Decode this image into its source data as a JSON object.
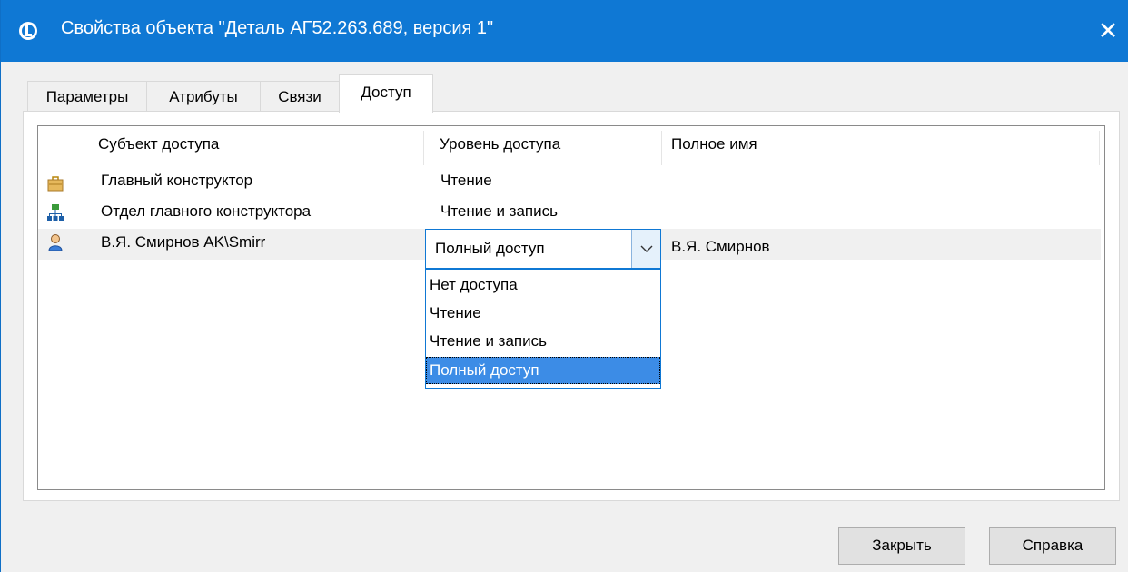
{
  "window": {
    "title": "Свойства объекта \"Деталь АГ52.263.689, версия 1\"",
    "close_glyph": "✕"
  },
  "tabs": [
    {
      "label": "Параметры",
      "active": false
    },
    {
      "label": "Атрибуты",
      "active": false
    },
    {
      "label": "Связи",
      "active": false
    },
    {
      "label": "Доступ",
      "active": true
    }
  ],
  "table": {
    "columns": [
      "Субъект доступа",
      "Уровень доступа",
      "Полное имя"
    ],
    "rows": [
      {
        "icon": "briefcase-icon",
        "subject": "Главный конструктор",
        "level": "Чтение",
        "full_name": ""
      },
      {
        "icon": "org-structure-icon",
        "subject": "Отдел главного конструктора",
        "level": "Чтение и запись",
        "full_name": ""
      },
      {
        "icon": "user-icon",
        "subject": "В.Я. Смирнов AK\\Smirr",
        "level": "Полный доступ",
        "full_name": "В.Я. Смирнов",
        "selected": true
      }
    ]
  },
  "level_combo": {
    "value": "Полный доступ",
    "options": [
      "Нет доступа",
      "Чтение",
      "Чтение и запись",
      "Полный доступ"
    ],
    "highlighted": "Полный доступ"
  },
  "buttons": {
    "close_label": "Закрыть",
    "help_label": "Справка"
  },
  "colors": {
    "titlebar": "#0f78d4",
    "selection": "#3c8ce6",
    "window_bg": "#f0f0f0"
  }
}
